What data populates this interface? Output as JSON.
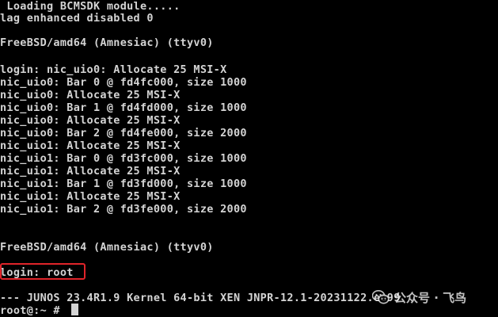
{
  "console": {
    "lines": [
      " Loading BCMSDK module.....",
      "lag enhanced disabled 0",
      "",
      "FreeBSD/amd64 (Amnesiac) (ttyv0)",
      "",
      "login: nic_uio0: Allocate 25 MSI-X",
      "nic_uio0: Bar 0 @ fd4fc000, size 1000",
      "nic_uio0: Allocate 25 MSI-X",
      "nic_uio0: Bar 1 @ fd4fd000, size 1000",
      "nic_uio0: Allocate 25 MSI-X",
      "nic_uio0: Bar 2 @ fd4fe000, size 2000",
      "nic_uio1: Allocate 25 MSI-X",
      "nic_uio1: Bar 0 @ fd3fc000, size 1000",
      "nic_uio1: Allocate 25 MSI-X",
      "nic_uio1: Bar 1 @ fd3fd000, size 1000",
      "nic_uio1: Allocate 25 MSI-X",
      "nic_uio1: Bar 2 @ fd3fe000, size 2000",
      "",
      "",
      "FreeBSD/amd64 (Amnesiac) (ttyv0)",
      "",
      "login: root",
      "",
      "--- JUNOS 23.4R1.9 Kernel 64-bit XEN JNPR-12.1-20231122.ee99",
      "root@:~ # "
    ],
    "highlighted_line": "login: root",
    "highlight_color": "#e0242a",
    "text_color": "#d4d4d4",
    "background_color": "#000000"
  },
  "watermark": {
    "icon": "wechat-icon",
    "text": "公众号 · 飞鸟"
  }
}
